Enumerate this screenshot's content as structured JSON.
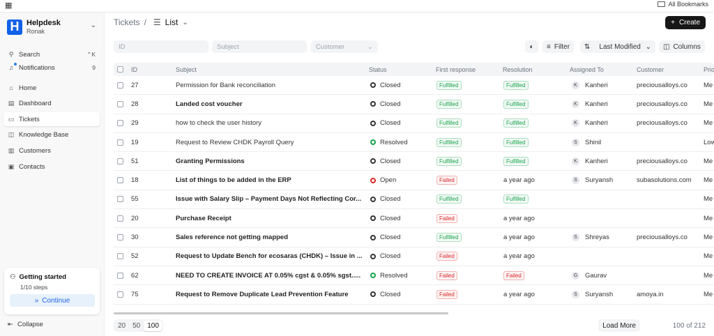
{
  "browser": {
    "bookmarks_label": "All Bookmarks"
  },
  "sidebar": {
    "brand_name": "Helpdesk",
    "brand_user": "Ronak",
    "search_label": "Search",
    "search_shortcut": "⌃K",
    "notifications_label": "Notifications",
    "notifications_count": "9",
    "items": [
      {
        "label": "Home",
        "icon": "home-icon"
      },
      {
        "label": "Dashboard",
        "icon": "dashboard-icon"
      },
      {
        "label": "Tickets",
        "icon": "ticket-icon",
        "active": true
      },
      {
        "label": "Knowledge Base",
        "icon": "book-icon"
      },
      {
        "label": "Customers",
        "icon": "building-icon"
      },
      {
        "label": "Contacts",
        "icon": "contact-icon"
      }
    ],
    "getting_started": {
      "title": "Getting started",
      "steps": "1/10 steps",
      "continue_label": "Continue"
    },
    "collapse_label": "Collapse"
  },
  "header": {
    "breadcrumb_parent": "Tickets",
    "breadcrumb_sep": "/",
    "view_label": "List",
    "create_label": "Create"
  },
  "filters": {
    "id_placeholder": "ID",
    "subject_placeholder": "Subject",
    "customer_placeholder": "Customer",
    "filter_label": "Filter",
    "sort_label": "Last Modified",
    "columns_label": "Columns"
  },
  "table": {
    "columns": [
      "ID",
      "Subject",
      "Status",
      "First response",
      "Resolution",
      "Assigned To",
      "Customer",
      "Prio"
    ],
    "rows": [
      {
        "id": "27",
        "subject": "Permission for Bank reconciliation",
        "bold": false,
        "status": "Closed",
        "first_response": "Fulfilled",
        "resolution": "Fulfilled",
        "assignee_initial": "K",
        "assignee": "Kanheri",
        "customer": "preciousalloys.co",
        "priority": "Me"
      },
      {
        "id": "28",
        "subject": "Landed cost voucher",
        "bold": true,
        "status": "Closed",
        "first_response": "Fulfilled",
        "resolution": "Fulfilled",
        "assignee_initial": "K",
        "assignee": "Kanheri",
        "customer": "preciousalloys.co",
        "priority": "Me"
      },
      {
        "id": "29",
        "subject": "how to check the user history",
        "bold": false,
        "status": "Closed",
        "first_response": "Fulfilled",
        "resolution": "Fulfilled",
        "assignee_initial": "K",
        "assignee": "Kanheri",
        "customer": "preciousalloys.co",
        "priority": "Me"
      },
      {
        "id": "19",
        "subject": "Request to Review CHDK Payroll Query",
        "bold": false,
        "status": "Resolved",
        "first_response": "Fulfilled",
        "resolution": "Fulfilled",
        "assignee_initial": "S",
        "assignee": "Shinil",
        "customer": "",
        "priority": "Low"
      },
      {
        "id": "51",
        "subject": "Granting Permissions",
        "bold": true,
        "status": "Closed",
        "first_response": "Fulfilled",
        "resolution": "Fulfilled",
        "assignee_initial": "K",
        "assignee": "Kanheri",
        "customer": "preciousalloys.co",
        "priority": "Me"
      },
      {
        "id": "18",
        "subject": "List of things to be added in the ERP",
        "bold": true,
        "status": "Open",
        "first_response": "Failed",
        "resolution": "a year ago",
        "assignee_initial": "S",
        "assignee": "Suryansh",
        "customer": "subasolutions.com",
        "priority": "Me"
      },
      {
        "id": "55",
        "subject": "Issue with Salary Slip – Payment Days Not Reflecting Cor...",
        "bold": true,
        "status": "Closed",
        "first_response": "Fulfilled",
        "resolution": "Fulfilled",
        "assignee_initial": "",
        "assignee": "",
        "customer": "",
        "priority": "Me"
      },
      {
        "id": "20",
        "subject": "Purchase Receipt",
        "bold": true,
        "status": "Closed",
        "first_response": "Failed",
        "resolution": "a year ago",
        "assignee_initial": "",
        "assignee": "",
        "customer": "",
        "priority": "Me"
      },
      {
        "id": "30",
        "subject": "Sales reference not getting mapped",
        "bold": true,
        "status": "Closed",
        "first_response": "Fulfilled",
        "resolution": "a year ago",
        "assignee_initial": "S",
        "assignee": "Shreyas",
        "customer": "preciousalloys.co",
        "priority": "Me"
      },
      {
        "id": "52",
        "subject": "Request to Update Bench for ecosaras (CHDK) – Issue in ...",
        "bold": true,
        "status": "Closed",
        "first_response": "Failed",
        "resolution": "a year ago",
        "assignee_initial": "",
        "assignee": "",
        "customer": "",
        "priority": "Me"
      },
      {
        "id": "62",
        "subject": "NEED TO CREATE INVOICE AT 0.05% cgst & 0.05% sgst.....",
        "bold": true,
        "status": "Resolved",
        "first_response": "Failed",
        "resolution": "Failed",
        "assignee_initial": "G",
        "assignee": "Gaurav",
        "customer": "",
        "priority": "Me"
      },
      {
        "id": "75",
        "subject": "Request to Remove Duplicate Lead Prevention Feature",
        "bold": true,
        "status": "Closed",
        "first_response": "Failed",
        "resolution": "a year ago",
        "assignee_initial": "S",
        "assignee": "Suryansh",
        "customer": "amoya.in",
        "priority": "Me"
      }
    ]
  },
  "footer": {
    "page_sizes": [
      "20",
      "50",
      "100"
    ],
    "selected_page_size": "100",
    "load_more_label": "Load More",
    "count_label": "100 of 212"
  },
  "colors": {
    "brand": "#1160e8",
    "closed": "#333333",
    "resolved": "#16a34a",
    "open": "#dc2626",
    "fulfilled": "#16a34a",
    "failed": "#dc2626"
  }
}
